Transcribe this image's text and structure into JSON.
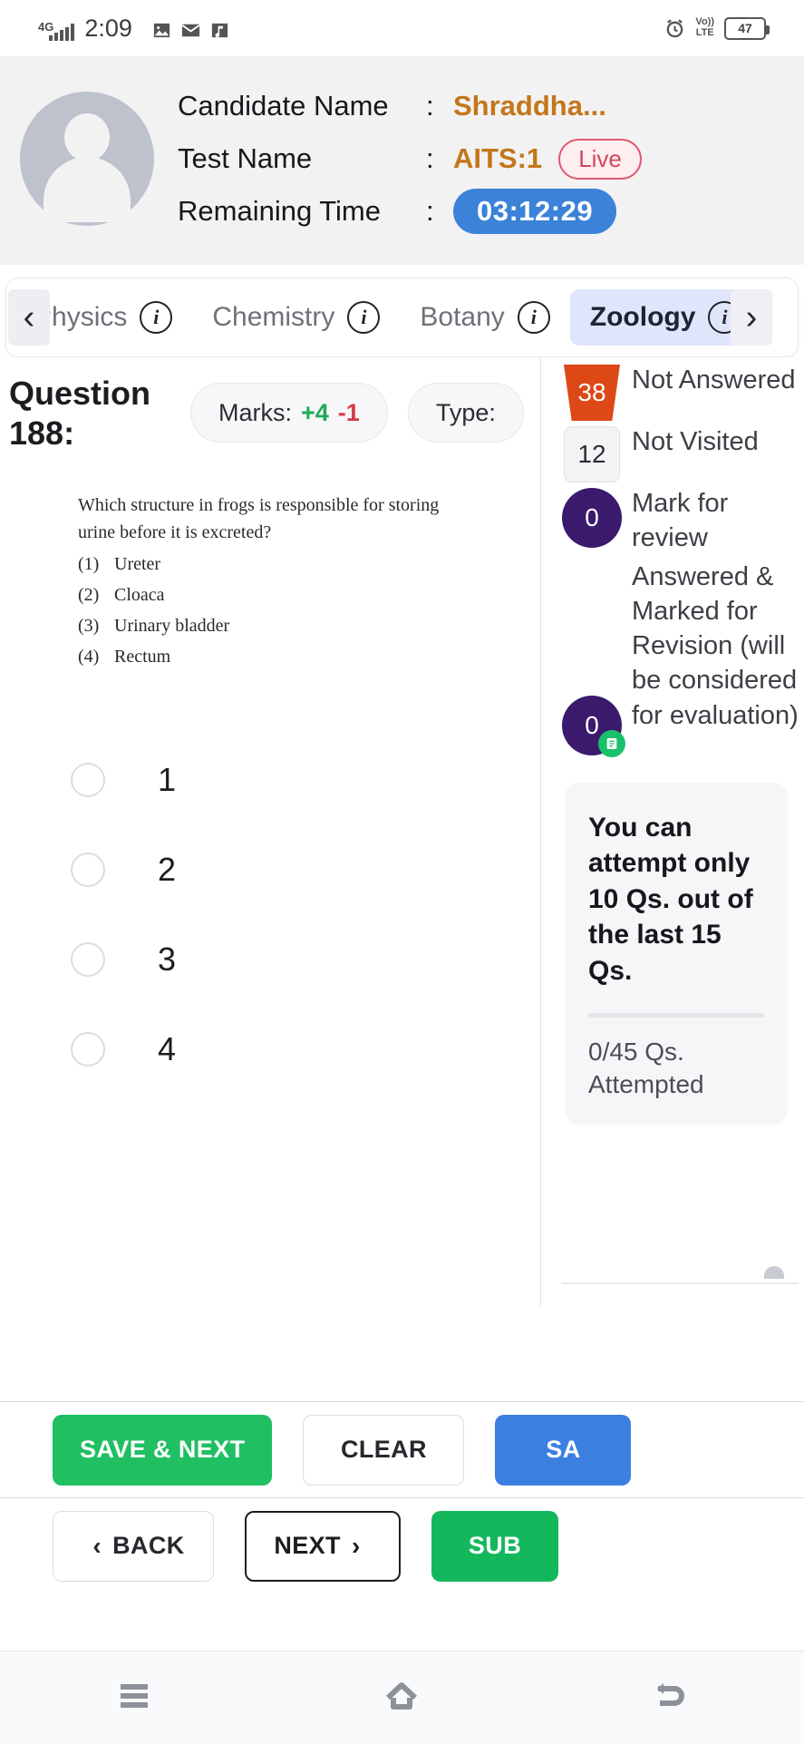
{
  "status_bar": {
    "network": "4G",
    "time": "2:09",
    "icons": [
      "image-notification-icon",
      "mail-icon",
      "music-notification-icon"
    ],
    "alarm_icon": "alarm-icon",
    "volte_line1": "Vo))",
    "volte_line2": "LTE",
    "battery": "47"
  },
  "header": {
    "candidate_label": "Candidate Name",
    "candidate_value": "Shraddha...",
    "test_label": "Test Name",
    "test_value": "AITS:1",
    "live_badge": "Live",
    "time_label": "Remaining Time",
    "time_value": "03:12:29",
    "colon": ":"
  },
  "tabs": {
    "prev_arrow": "‹",
    "next_arrow": "›",
    "items": [
      {
        "label": "Physics",
        "active": false
      },
      {
        "label": "Chemistry",
        "active": false
      },
      {
        "label": "Botany",
        "active": false
      },
      {
        "label": "Zoology",
        "active": true
      }
    ]
  },
  "question": {
    "title": "Question 188:",
    "marks_label": "Marks:",
    "marks_positive": "+4",
    "marks_negative": "-1",
    "type_label": "Type:",
    "stem_line1": "Which structure in frogs is responsible for storing",
    "stem_line2": "urine before it is excreted?",
    "stem_options": [
      {
        "num": "(1)",
        "text": "Ureter"
      },
      {
        "num": "(2)",
        "text": "Cloaca"
      },
      {
        "num": "(3)",
        "text": "Urinary bladder"
      },
      {
        "num": "(4)",
        "text": "Rectum"
      }
    ],
    "choices": [
      "1",
      "2",
      "3",
      "4"
    ]
  },
  "legend": [
    {
      "count": "38",
      "label": "Not Answered",
      "shape": "pentagon",
      "color": "#dd4817"
    },
    {
      "count": "12",
      "label": "Not Visited",
      "shape": "square",
      "color": "#f4f4f6"
    },
    {
      "count": "0",
      "label": "Mark for review",
      "shape": "circle",
      "color": "#3b1a6e"
    },
    {
      "count": "0",
      "label": "Answered & Marked for Revision (will be considered for evaluation)",
      "shape": "circle-check",
      "color": "#3b1a6e"
    }
  ],
  "note": {
    "title": "You can attempt only 10 Qs. out of the last 15 Qs.",
    "attempted": "0/45 Qs. Attempted"
  },
  "footer": {
    "save_next": "SAVE & NEXT",
    "clear": "CLEAR",
    "save_blue": "SA",
    "back": "BACK",
    "back_chevron": "‹",
    "next": "NEXT",
    "next_chevron": "›",
    "submit": "SUB"
  },
  "android_nav": {
    "recents": "menu-icon",
    "home": "home-icon",
    "back": "back-icon"
  },
  "colors": {
    "accent_orange": "#c4761a",
    "live_red": "#d3465c",
    "timer_blue": "#3b82d8",
    "green": "#1fbf62",
    "purple": "#3b1a6e"
  }
}
